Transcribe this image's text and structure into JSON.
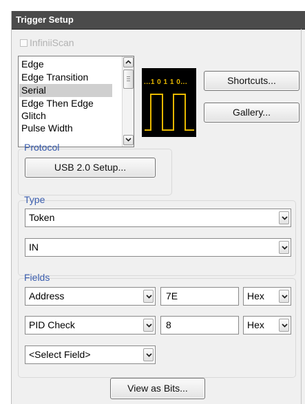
{
  "window": {
    "title": "Trigger Setup"
  },
  "infiniiscan": {
    "label": "InfiniiScan",
    "checked": false,
    "enabled": false
  },
  "trigger_types": {
    "items": [
      "Edge",
      "Edge Transition",
      "Serial",
      "Edge Then Edge",
      "Glitch",
      "Pulse Width"
    ],
    "selected": "Serial"
  },
  "preview": {
    "bits": "...1 0 1 1 0...",
    "icon": "serial-waveform-icon"
  },
  "buttons": {
    "shortcuts": "Shortcuts...",
    "gallery": "Gallery...",
    "view_as_bits": "View as Bits..."
  },
  "protocol": {
    "label": "Protocol",
    "setup_button": "USB 2.0 Setup..."
  },
  "type": {
    "label": "Type",
    "token": "Token",
    "direction": "IN"
  },
  "fields": {
    "label": "Fields",
    "rows": [
      {
        "field": "Address",
        "value": "7E",
        "format": "Hex"
      },
      {
        "field": "PID Check",
        "value": "8",
        "format": "Hex"
      }
    ],
    "add_field": "<Select Field>"
  },
  "colors": {
    "titlebar": "#4b4b4b",
    "group_label": "#3a5dae",
    "waveform": "#e8b800",
    "selection": "#cfcfcf"
  }
}
